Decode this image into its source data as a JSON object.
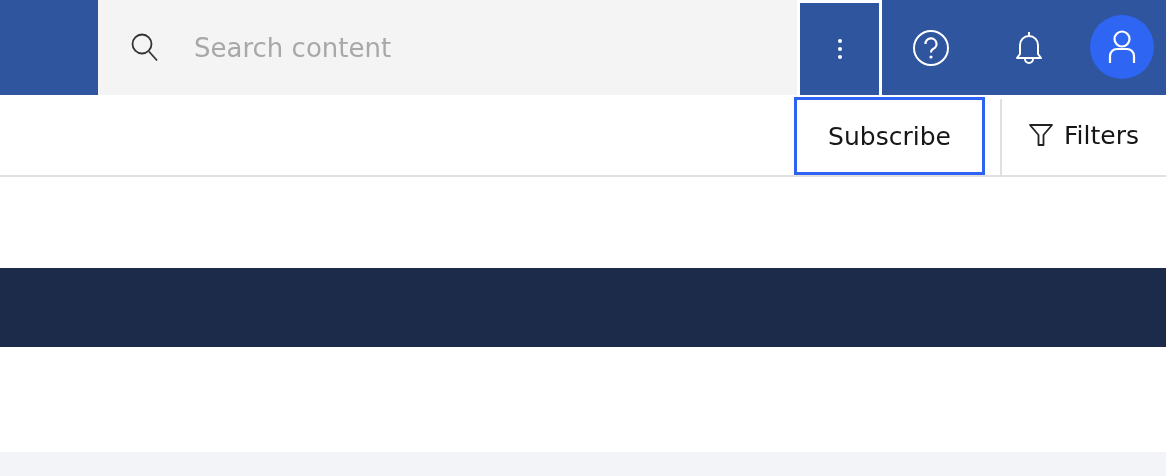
{
  "header": {
    "search": {
      "placeholder": "Search content"
    },
    "overflow_menu": {
      "expanded": true
    }
  },
  "toolbar": {
    "subscribe": {
      "label": "Subscribe",
      "focused": true
    },
    "filters": {
      "label": "Filters"
    }
  }
}
